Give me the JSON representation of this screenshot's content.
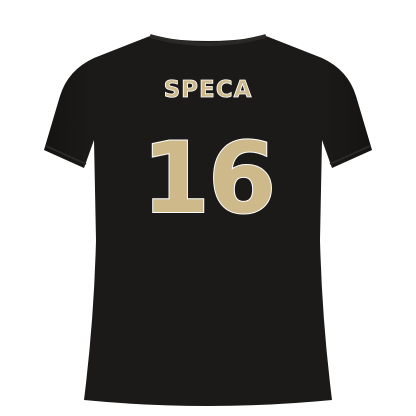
{
  "product": {
    "shirt_color": "#1c1a18",
    "print_fill": "#cdb98a",
    "print_outline": "#ffffff",
    "player_name": "SPECA",
    "player_number": "16"
  }
}
